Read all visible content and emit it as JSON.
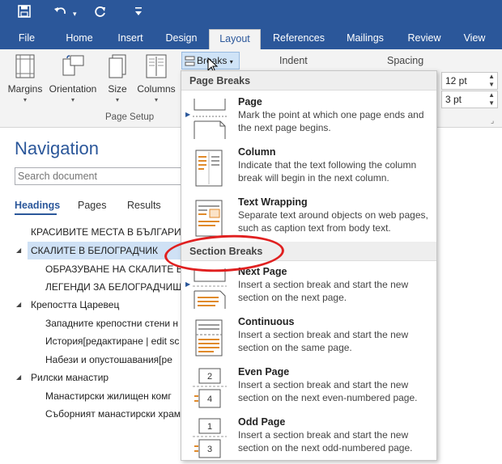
{
  "qat": {
    "save_icon": "save-icon",
    "undo_icon": "undo-icon",
    "redo_icon": "redo-icon",
    "customize_icon": "customize-icon"
  },
  "tabs": [
    "File",
    "Home",
    "Insert",
    "Design",
    "Layout",
    "References",
    "Mailings",
    "Review",
    "View"
  ],
  "active_tab": "Layout",
  "ribbon": {
    "margins": "Margins",
    "orientation": "Orientation",
    "size": "Size",
    "columns": "Columns",
    "page_setup_label": "Page Setup",
    "breaks": "Breaks",
    "indent": "Indent",
    "spacing": "Spacing",
    "spacing_before": "12 pt",
    "spacing_after": "3 pt"
  },
  "navigation": {
    "title": "Navigation",
    "search_placeholder": "Search document",
    "tabs": [
      "Headings",
      "Pages",
      "Results"
    ],
    "tree": [
      "КРАСИВИТЕ МЕСТА В БЪЛГАРИ",
      "СКАЛИТЕ В БЕЛОГРАДЧИК",
      "ОБРАЗУВАНЕ НА СКАЛИТЕ В",
      "ЛЕГЕНДИ ЗА БЕЛОГРАДЧИШ",
      "Крепостта Царевец",
      "Западните крепостни стени н",
      "История[редактиране | edit sc",
      "Набези и опустошавания[ре",
      "Рилски манастир",
      "Манастирски жилищен комг",
      "Съборният манастирски храм"
    ]
  },
  "breaks_menu": {
    "page_breaks_header": "Page Breaks",
    "section_breaks_header": "Section Breaks",
    "items": [
      {
        "title": "Page",
        "desc": "Mark the point at which one page ends and the next page begins."
      },
      {
        "title": "Column",
        "desc": "Indicate that the text following the column break will begin in the next column."
      },
      {
        "title": "Text Wrapping",
        "desc": "Separate text around objects on web pages, such as caption text from body text."
      },
      {
        "title": "Next Page",
        "desc": "Insert a section break and start the new section on the next page."
      },
      {
        "title": "Continuous",
        "desc": "Insert a section break and start the new section on the same page."
      },
      {
        "title": "Even Page",
        "desc": "Insert a section break and start the new section on the next even-numbered page."
      },
      {
        "title": "Odd Page",
        "desc": "Insert a section break and start the new section on the next odd-numbered page."
      }
    ]
  },
  "colors": {
    "accent": "#2b579a",
    "highlight": "#e02020"
  }
}
